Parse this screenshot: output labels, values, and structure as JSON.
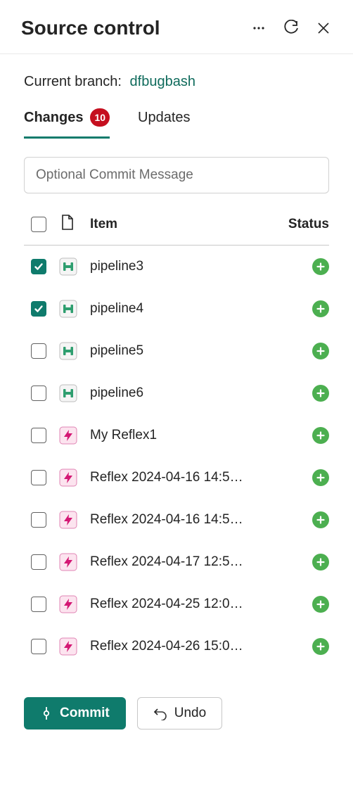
{
  "header": {
    "title": "Source control"
  },
  "branch": {
    "label": "Current branch:",
    "name": "dfbugbash"
  },
  "tabs": {
    "changes": {
      "label": "Changes",
      "count": "10"
    },
    "updates": {
      "label": "Updates"
    }
  },
  "commit_input": {
    "placeholder": "Optional Commit Message",
    "value": ""
  },
  "columns": {
    "item": "Item",
    "status": "Status"
  },
  "items": [
    {
      "checked": true,
      "type": "pipeline",
      "name": "pipeline3",
      "status": "added"
    },
    {
      "checked": true,
      "type": "pipeline",
      "name": "pipeline4",
      "status": "added"
    },
    {
      "checked": false,
      "type": "pipeline",
      "name": "pipeline5",
      "status": "added"
    },
    {
      "checked": false,
      "type": "pipeline",
      "name": "pipeline6",
      "status": "added"
    },
    {
      "checked": false,
      "type": "reflex",
      "name": "My Reflex1",
      "status": "added"
    },
    {
      "checked": false,
      "type": "reflex",
      "name": "Reflex 2024-04-16 14:5…",
      "status": "added"
    },
    {
      "checked": false,
      "type": "reflex",
      "name": "Reflex 2024-04-16 14:5…",
      "status": "added"
    },
    {
      "checked": false,
      "type": "reflex",
      "name": "Reflex 2024-04-17 12:5…",
      "status": "added"
    },
    {
      "checked": false,
      "type": "reflex",
      "name": "Reflex 2024-04-25 12:0…",
      "status": "added"
    },
    {
      "checked": false,
      "type": "reflex",
      "name": "Reflex 2024-04-26 15:0…",
      "status": "added"
    }
  ],
  "buttons": {
    "commit": "Commit",
    "undo": "Undo"
  }
}
